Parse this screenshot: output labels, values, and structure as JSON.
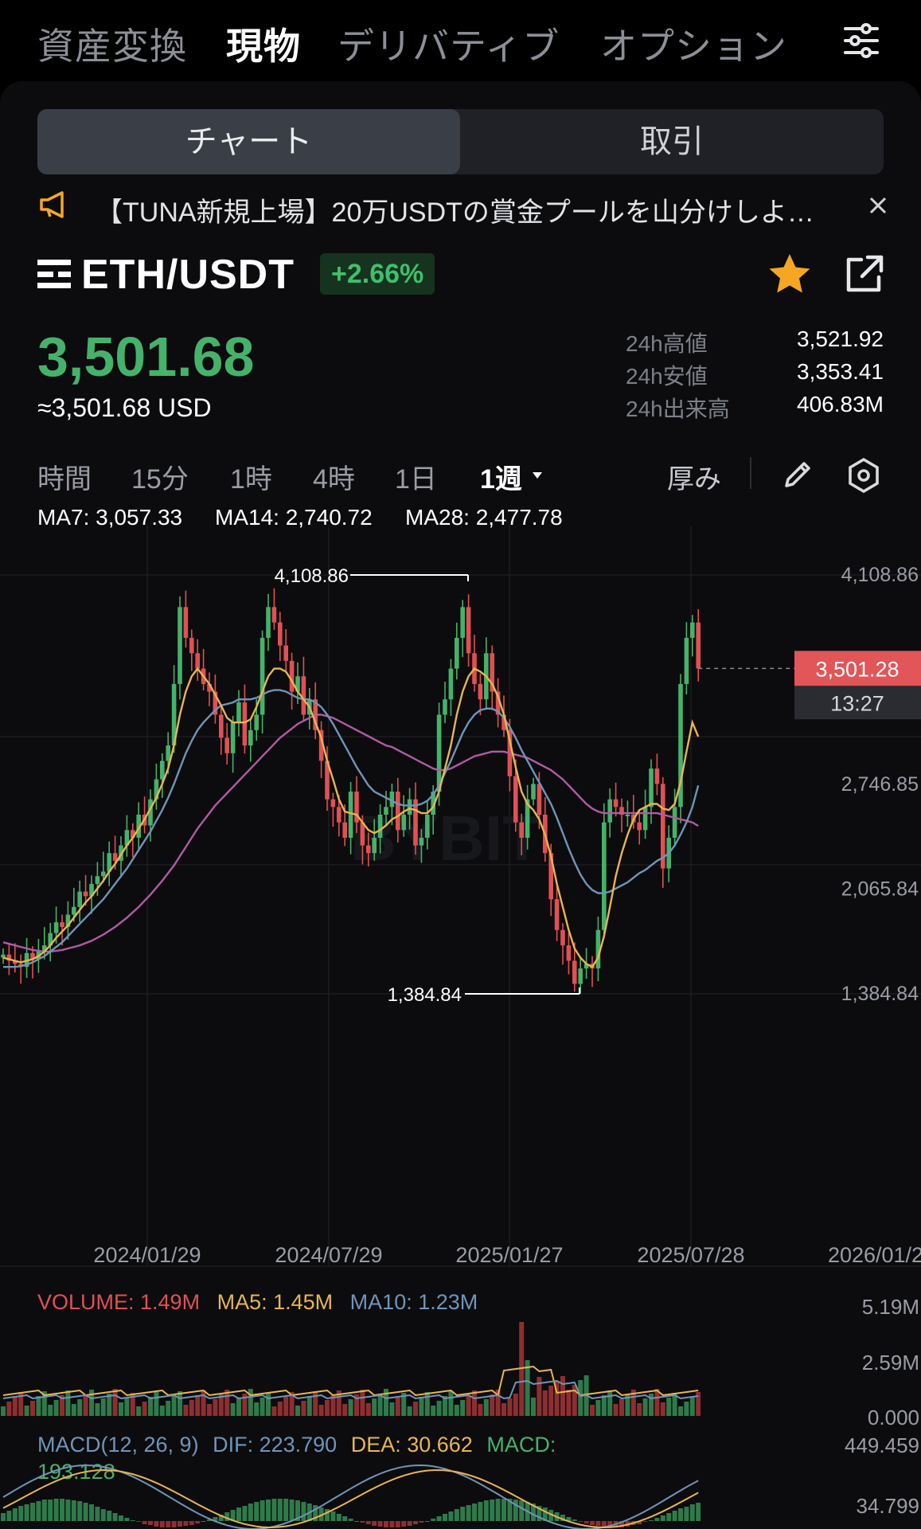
{
  "top_nav": {
    "tabs": [
      "資産変換",
      "現物",
      "デリバティブ",
      "オプション"
    ],
    "active_index": 1
  },
  "segment": {
    "options": [
      "チャート",
      "取引"
    ],
    "active_index": 0
  },
  "notice": {
    "text": "【TUNA新規上場】20万USDTの賞金プールを山分けしよ…"
  },
  "ticker": {
    "pair": "ETH/USDT",
    "change": "+2.66%",
    "price": "3,501.68",
    "usd_value": "≈3,501.68 USD",
    "stats": [
      {
        "label": "24h高値",
        "value": "3,521.92"
      },
      {
        "label": "24h安値",
        "value": "3,353.41"
      },
      {
        "label": "24h出来高",
        "value": "406.83M"
      }
    ]
  },
  "timeframes": {
    "items": [
      "時間",
      "15分",
      "1時",
      "4時",
      "1日",
      "1週"
    ],
    "active": "1週",
    "depth_label": "厚み"
  },
  "ma_legend": [
    {
      "label": "MA7: 3,057.33",
      "color": "#e8b64c"
    },
    {
      "label": "MA14: 2,740.72",
      "color": "#6f95b8"
    },
    {
      "label": "MA28: 2,477.78",
      "color": "#b25aa3"
    }
  ],
  "colors": {
    "up": "#45b26b",
    "down": "#e05054",
    "ma7": "#e8b64c",
    "ma14": "#6f95b8",
    "ma28": "#b25aa3",
    "accent": "#f5a623"
  },
  "chart_data": {
    "type": "candlestick",
    "y_ticks": [
      "4,108.86",
      "2,746.85",
      "2,065.84",
      "1,384.84"
    ],
    "x_ticks": [
      "2024/01/29",
      "2024/07/29",
      "2025/01/27",
      "2025/07/28",
      "2026/01/2"
    ],
    "high_label": "4,108.86",
    "low_label": "1,384.84",
    "last_price": "3,501.28",
    "countdown": "13:27",
    "ylim": [
      1384.84,
      4108.86
    ],
    "closes": [
      1640,
      1600,
      1580,
      1560,
      1650,
      1610,
      1660,
      1700,
      1780,
      1850,
      1820,
      1900,
      1950,
      2050,
      2020,
      2100,
      2150,
      2180,
      2300,
      2250,
      2350,
      2450,
      2400,
      2550,
      2480,
      2650,
      2780,
      2900,
      3000,
      3400,
      3900,
      3700,
      3600,
      3500,
      3400,
      3350,
      3200,
      3050,
      2950,
      3150,
      3280,
      3000,
      3100,
      3200,
      3700,
      3900,
      3800,
      3650,
      3550,
      3350,
      3450,
      3200,
      3300,
      3100,
      2900,
      2650,
      2600,
      2500,
      2400,
      2700,
      2500,
      2350,
      2300,
      2400,
      2550,
      2600,
      2700,
      2450,
      2550,
      2650,
      2350,
      2400,
      2550,
      2700,
      3200,
      3300,
      3500,
      3700,
      3900,
      3600,
      3400,
      3300,
      3600,
      3350,
      3200,
      3100,
      2800,
      2500,
      2400,
      2650,
      2750,
      2550,
      2300,
      2000,
      1800,
      1700,
      1600,
      1450,
      1550,
      1580,
      1550,
      1800,
      2500,
      2650,
      2600,
      2550,
      2550,
      2500,
      2450,
      2600,
      2850,
      2750,
      2200,
      2400,
      2600,
      3400,
      3700,
      3800,
      3501
    ],
    "ma7": [
      1620,
      1610,
      1600,
      1590,
      1600,
      1610,
      1630,
      1660,
      1700,
      1750,
      1790,
      1830,
      1880,
      1930,
      1980,
      2020,
      2070,
      2120,
      2180,
      2230,
      2290,
      2350,
      2400,
      2460,
      2520,
      2590,
      2660,
      2750,
      2850,
      3000,
      3200,
      3350,
      3450,
      3500,
      3450,
      3400,
      3330,
      3260,
      3180,
      3150,
      3150,
      3150,
      3170,
      3250,
      3350,
      3450,
      3500,
      3500,
      3480,
      3420,
      3350,
      3300,
      3250,
      3150,
      3050,
      2900,
      2780,
      2650,
      2570,
      2560,
      2550,
      2500,
      2450,
      2430,
      2450,
      2480,
      2520,
      2540,
      2570,
      2590,
      2580,
      2560,
      2560,
      2600,
      2700,
      2850,
      3000,
      3200,
      3350,
      3450,
      3500,
      3480,
      3450,
      3400,
      3320,
      3200,
      3030,
      2860,
      2700,
      2620,
      2580,
      2520,
      2420,
      2280,
      2100,
      1950,
      1800,
      1680,
      1620,
      1580,
      1560,
      1620,
      1760,
      1950,
      2150,
      2300,
      2420,
      2520,
      2580,
      2600,
      2620,
      2620,
      2590,
      2580,
      2620,
      2760,
      2960,
      3150,
      3057
    ],
    "ma14": [
      1560,
      1560,
      1560,
      1565,
      1575,
      1590,
      1610,
      1630,
      1660,
      1690,
      1720,
      1760,
      1800,
      1840,
      1880,
      1920,
      1960,
      2000,
      2050,
      2100,
      2150,
      2200,
      2260,
      2320,
      2380,
      2440,
      2510,
      2580,
      2660,
      2750,
      2850,
      2950,
      3030,
      3100,
      3150,
      3190,
      3230,
      3260,
      3270,
      3280,
      3300,
      3300,
      3300,
      3310,
      3330,
      3350,
      3360,
      3360,
      3350,
      3330,
      3310,
      3300,
      3300,
      3280,
      3250,
      3200,
      3140,
      3070,
      3000,
      2930,
      2860,
      2800,
      2740,
      2700,
      2680,
      2660,
      2640,
      2620,
      2610,
      2610,
      2610,
      2620,
      2640,
      2680,
      2740,
      2820,
      2900,
      2990,
      3080,
      3150,
      3200,
      3230,
      3240,
      3240,
      3220,
      3180,
      3120,
      3050,
      2970,
      2900,
      2830,
      2760,
      2690,
      2620,
      2530,
      2430,
      2330,
      2240,
      2160,
      2100,
      2060,
      2040,
      2040,
      2050,
      2070,
      2090,
      2110,
      2140,
      2170,
      2190,
      2220,
      2250,
      2270,
      2300,
      2350,
      2420,
      2500,
      2600,
      2740
    ],
    "ma28": [
      1720,
      1710,
      1700,
      1690,
      1680,
      1670,
      1665,
      1660,
      1660,
      1665,
      1670,
      1680,
      1690,
      1700,
      1715,
      1730,
      1750,
      1770,
      1795,
      1820,
      1850,
      1880,
      1915,
      1950,
      1990,
      2030,
      2075,
      2120,
      2170,
      2220,
      2280,
      2340,
      2400,
      2460,
      2510,
      2560,
      2610,
      2650,
      2690,
      2730,
      2770,
      2810,
      2850,
      2890,
      2930,
      2970,
      3010,
      3050,
      3080,
      3110,
      3140,
      3160,
      3180,
      3200,
      3200,
      3190,
      3180,
      3160,
      3140,
      3120,
      3100,
      3080,
      3060,
      3040,
      3020,
      3000,
      2990,
      2970,
      2950,
      2930,
      2910,
      2890,
      2870,
      2850,
      2840,
      2840,
      2850,
      2870,
      2890,
      2910,
      2930,
      2940,
      2950,
      2960,
      2960,
      2960,
      2950,
      2940,
      2930,
      2920,
      2900,
      2880,
      2860,
      2840,
      2810,
      2780,
      2740,
      2700,
      2660,
      2620,
      2590,
      2570,
      2560,
      2560,
      2560,
      2560,
      2560,
      2560,
      2560,
      2560,
      2560,
      2560,
      2550,
      2540,
      2530,
      2520,
      2510,
      2500,
      2477
    ]
  },
  "volume": {
    "legend": [
      {
        "label": "VOLUME: 1.49M",
        "color": "#e05054"
      },
      {
        "label": "MA5: 1.45M",
        "color": "#e8b64c"
      },
      {
        "label": "MA10: 1.23M",
        "color": "#6f95b8"
      }
    ],
    "axis": [
      "5.19M",
      "2.59M",
      "0.000"
    ]
  },
  "macd": {
    "legend": [
      {
        "label": "MACD(12, 26, 9)",
        "color": "#6f95b8"
      },
      {
        "label": "DIF: 223.790",
        "color": "#6f95b8"
      },
      {
        "label": "DEA: 30.662",
        "color": "#e8b64c"
      },
      {
        "label": "MACD:",
        "color": "#45b26b"
      }
    ],
    "legend_line2": "193.128",
    "axis": [
      "449.459",
      "34.799"
    ]
  }
}
